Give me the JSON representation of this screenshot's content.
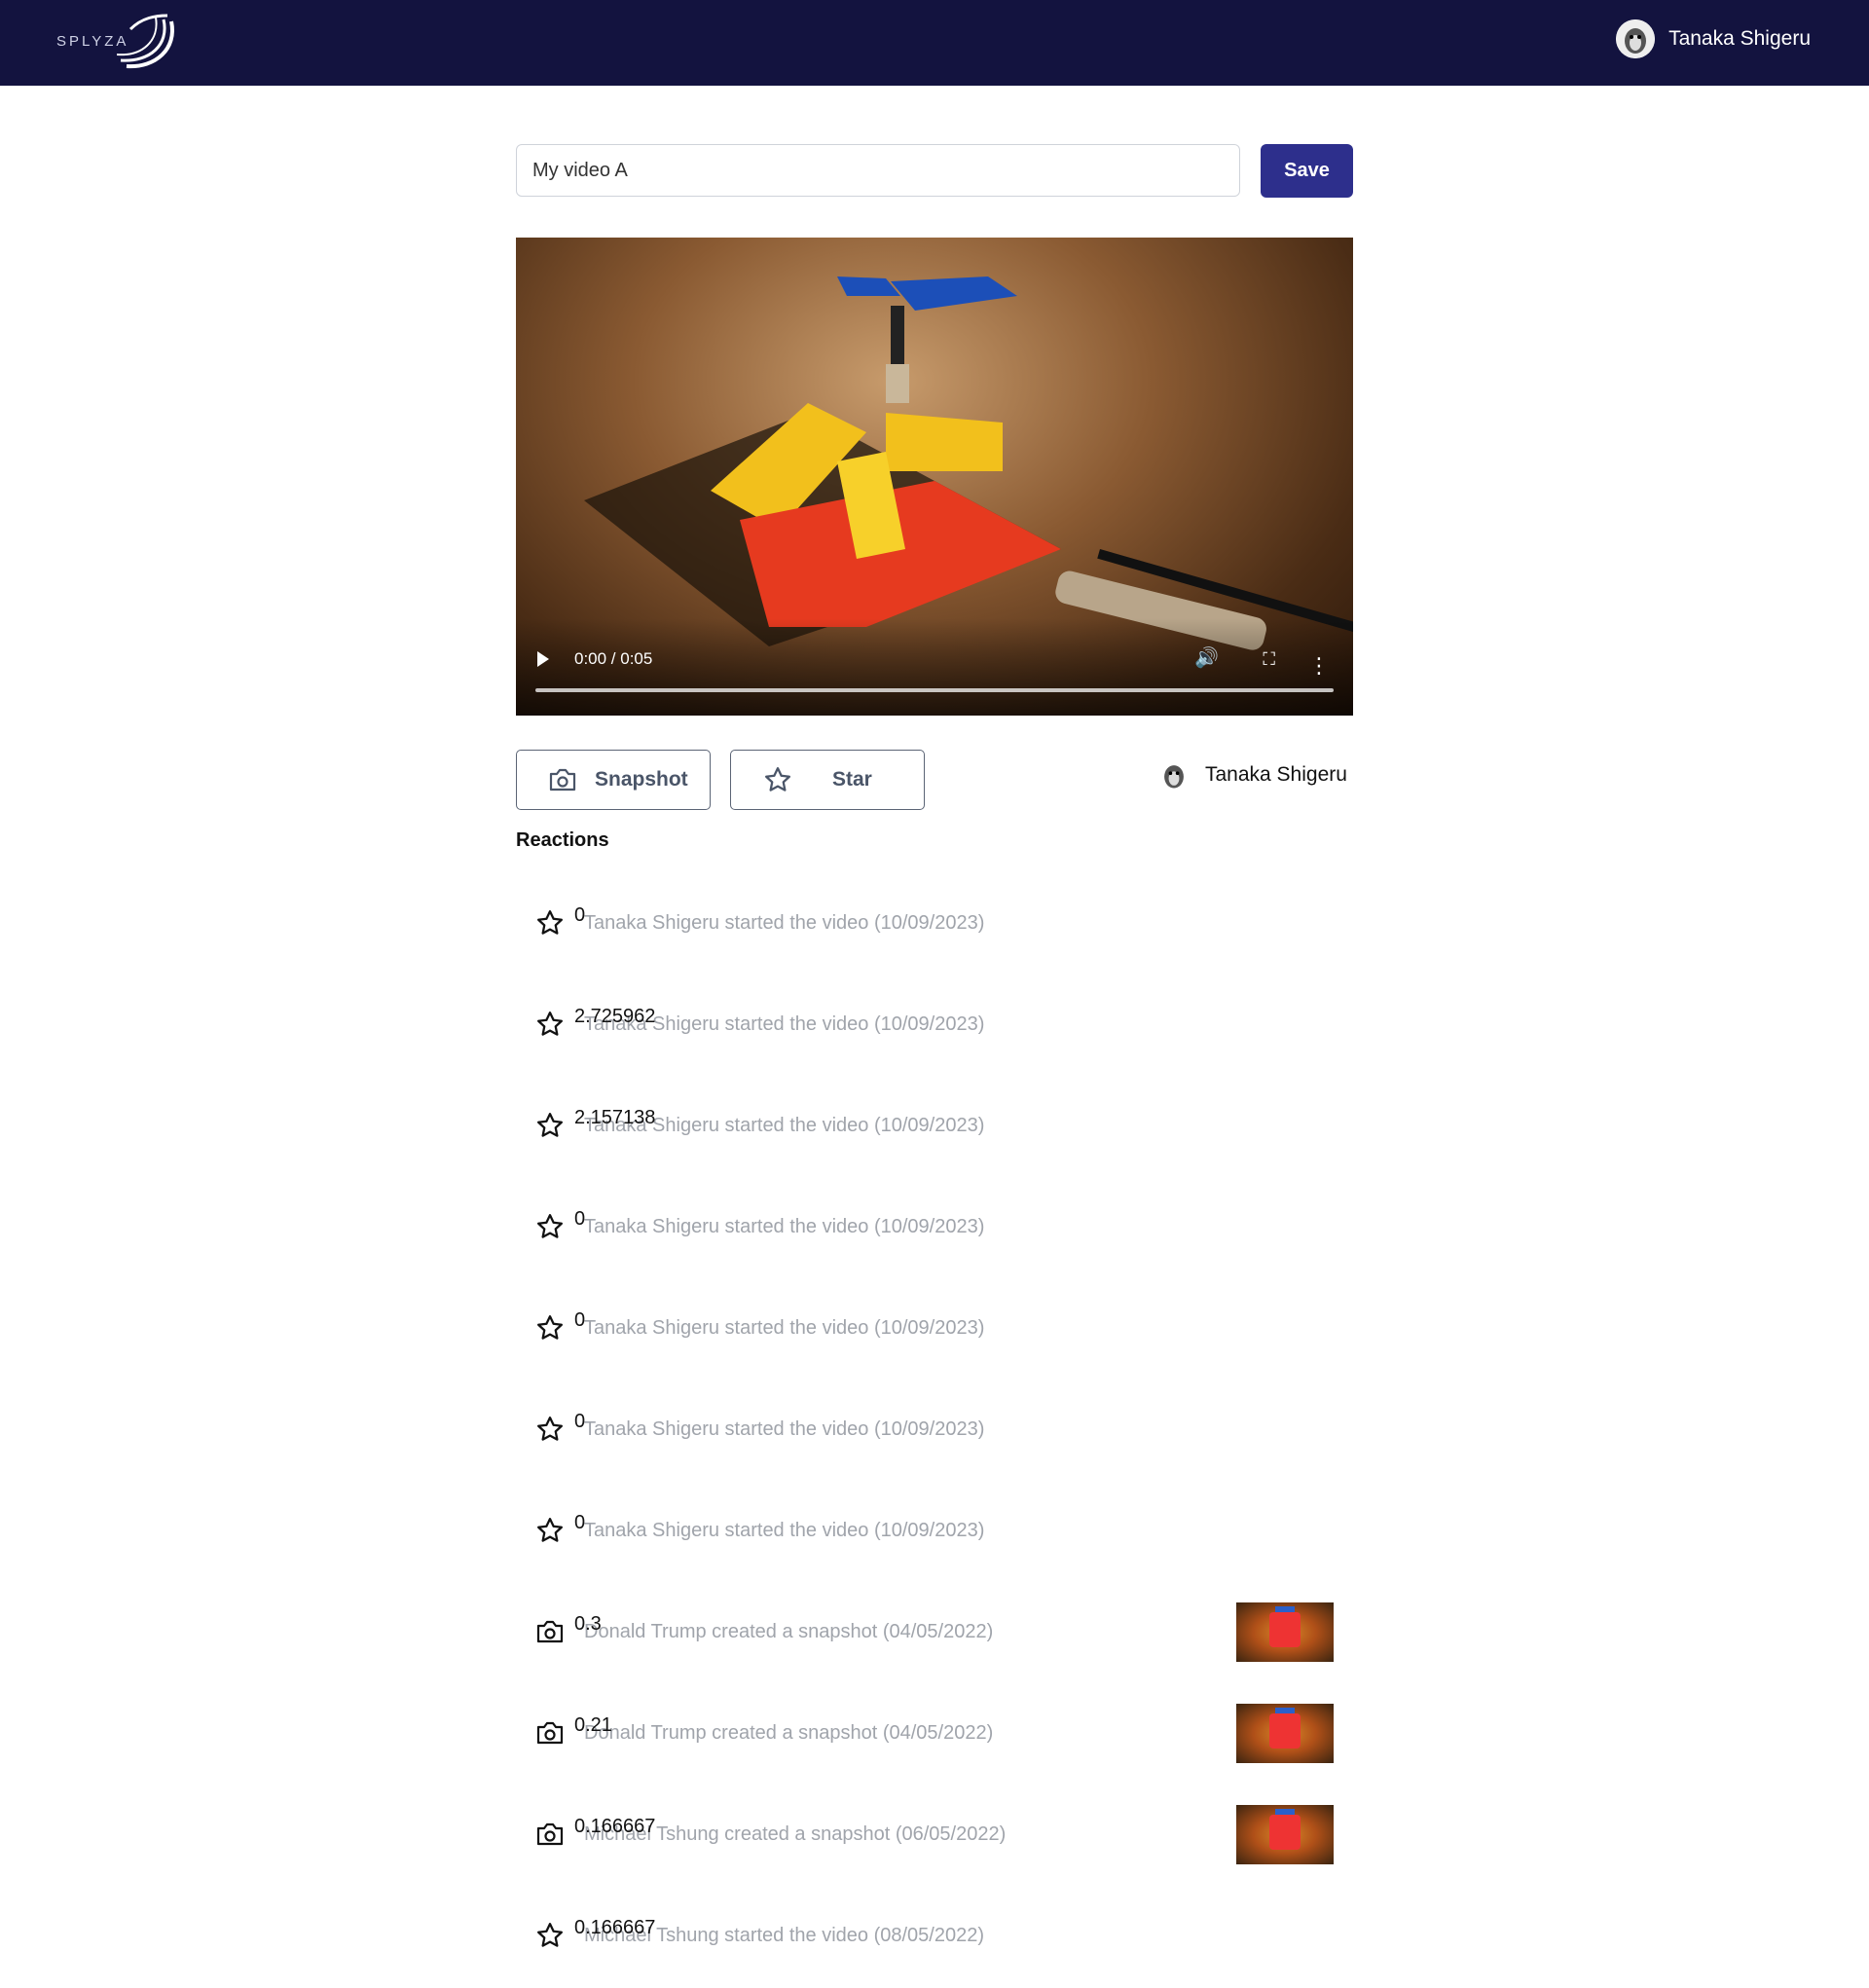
{
  "header": {
    "logo_text": "SPLYZA",
    "user_name": "Tanaka Shigeru"
  },
  "editor": {
    "title_value": "My video A",
    "save_label": "Save"
  },
  "video": {
    "time_display": "0:00 / 0:05",
    "progress": 0
  },
  "actions": {
    "snapshot_label": "Snapshot",
    "star_label": "Star",
    "owner_name": "Tanaka Shigeru"
  },
  "reactions": {
    "heading": "Reactions",
    "items": [
      {
        "type": "star",
        "time": "0",
        "text": "Tanaka Shigeru started the video (10/09/2023)"
      },
      {
        "type": "star",
        "time": "2.725962",
        "text": "Tanaka Shigeru started the video (10/09/2023)"
      },
      {
        "type": "star",
        "time": "2.157138",
        "text": "Tanaka Shigeru started the video (10/09/2023)"
      },
      {
        "type": "star",
        "time": "0",
        "text": "Tanaka Shigeru started the video (10/09/2023)"
      },
      {
        "type": "star",
        "time": "0",
        "text": "Tanaka Shigeru started the video (10/09/2023)"
      },
      {
        "type": "star",
        "time": "0",
        "text": "Tanaka Shigeru started the video (10/09/2023)"
      },
      {
        "type": "star",
        "time": "0",
        "text": "Tanaka Shigeru started the video (10/09/2023)"
      },
      {
        "type": "camera",
        "time": "0.3",
        "text": "Donald Trump created a snapshot (04/05/2022)",
        "thumbnail": true
      },
      {
        "type": "camera",
        "time": "0.21",
        "text": "Donald Trump created a snapshot (04/05/2022)",
        "thumbnail": true
      },
      {
        "type": "camera",
        "time": "0.166667",
        "text": "Michael Tshung created a snapshot (06/05/2022)",
        "thumbnail": true
      },
      {
        "type": "star",
        "time": "0.166667",
        "text": "Michael Tshung started the video (08/05/2022)"
      }
    ]
  },
  "colors": {
    "topbar": "#13133f",
    "accent": "#2d2f8c",
    "muted_text": "#a0a4ab"
  }
}
